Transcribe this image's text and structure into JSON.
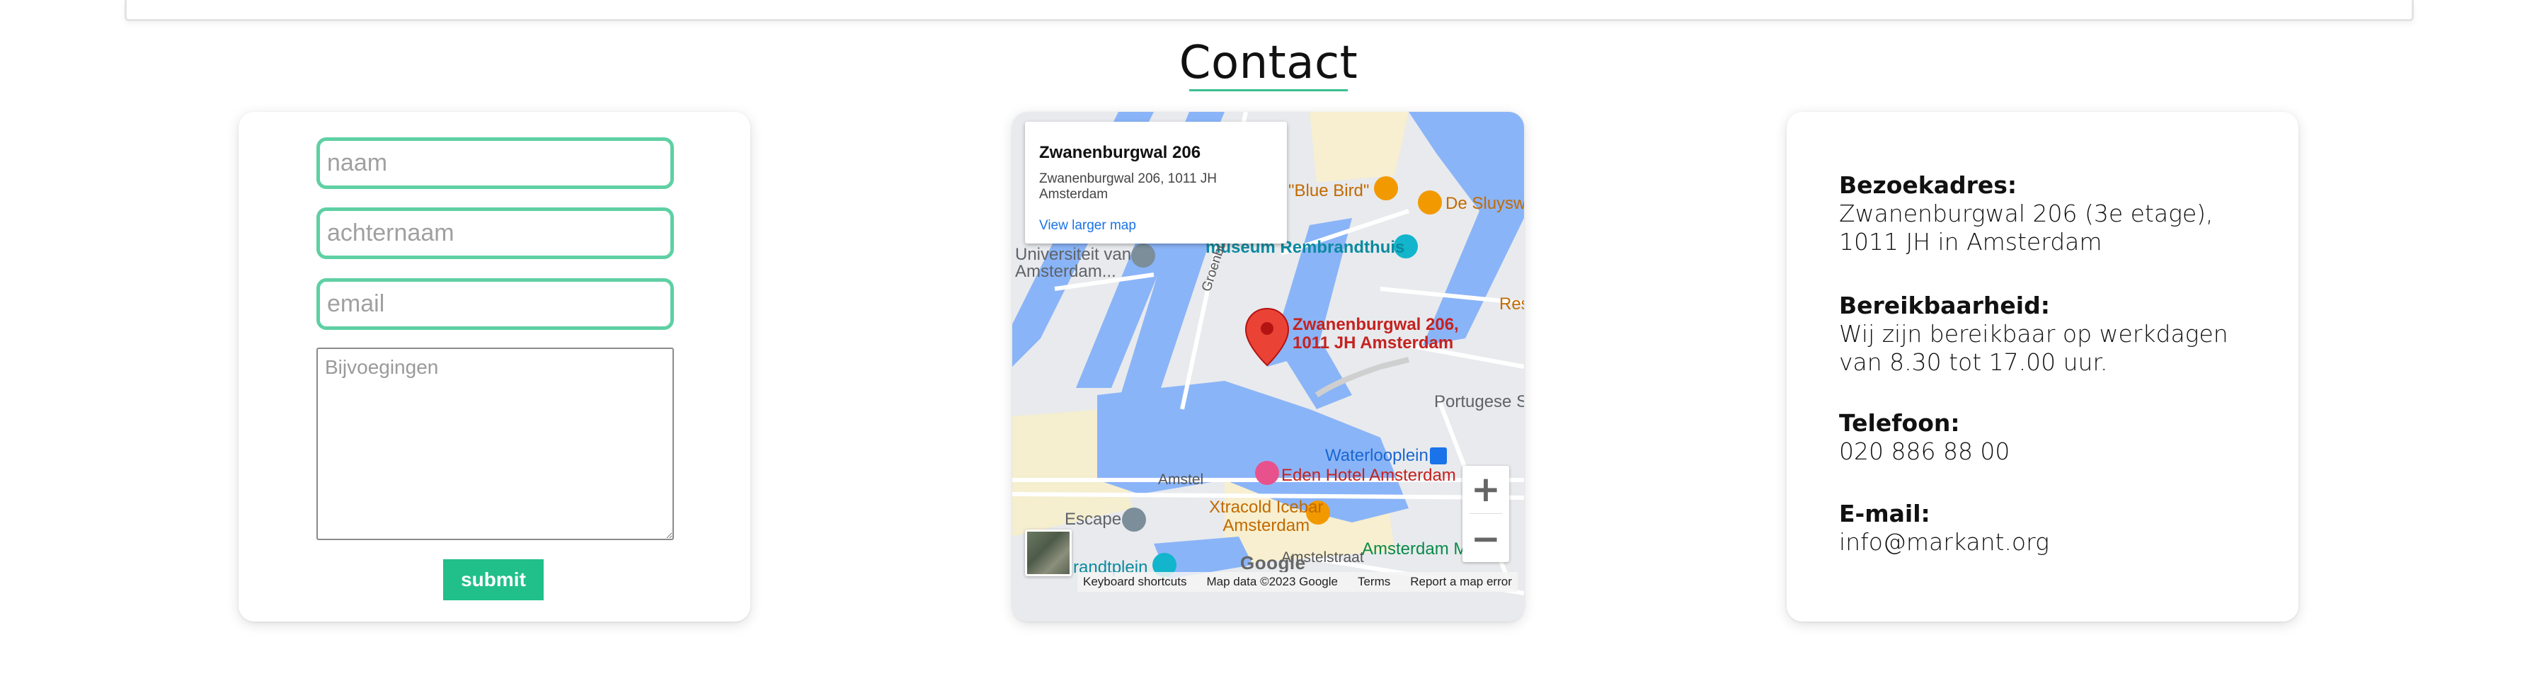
{
  "section": {
    "title": "Contact"
  },
  "form": {
    "fields": [
      {
        "placeholder": "naam"
      },
      {
        "placeholder": "achternaam"
      },
      {
        "placeholder": "email"
      }
    ],
    "attachments_placeholder": "Bijvoegingen",
    "submit_label": "submit"
  },
  "map": {
    "popup": {
      "title": "Zwanenburgwal 206",
      "address": "Zwanenburgwal 206, 1011 JH Amsterdam",
      "larger_map_link": "View larger map"
    },
    "marker_label_1": "Zwanenburgwal 206,",
    "marker_label_2": "1011 JH Amsterdam",
    "labels": {
      "blue_bird": "\"Blue Bird\"",
      "de_sluyswacht": "De Sluysw",
      "universiteit_1": "Universiteit van",
      "universiteit_2": "Amsterdam...",
      "museum": "museum Rembrandthuis",
      "groenburgwal": "Groenburgwal",
      "res": "Res",
      "portugese": "Portugese S",
      "waterlooplein": "Waterlooplein",
      "eden_hotel": "Eden Hotel Amsterdam",
      "amstel": "Amstel",
      "escape": "Escape",
      "xtracold_1": "Xtracold Icebar",
      "xtracold_2": "Amsterdam",
      "rembrandtplein": "randtplein",
      "amstelstraat": "Amstelstraat",
      "amsterdam_m": "Amsterdam M"
    },
    "zoom_in": "+",
    "zoom_out": "−",
    "google_logo": "Google",
    "attribution": {
      "shortcuts": "Keyboard shortcuts",
      "data": "Map data ©2023 Google",
      "terms": "Terms",
      "report": "Report a map error"
    },
    "colors": {
      "water": "#8ab4f8",
      "land": "#e8eaed",
      "park": "#f8f0d8",
      "marker": "#ea4335"
    }
  },
  "info": {
    "visit_label": "Bezoekadres:",
    "visit_text": "Zwanenburgwal 206 (3e etage), 1011 JH in Amsterdam",
    "reach_label": "Bereikbaarheid:",
    "reach_text": "Wij zijn bereikbaar op werkdagen van 8.30 tot 17.00 uur.",
    "phone_label": "Telefoon:",
    "phone_text": "020 886 88 00",
    "email_label": "E-mail:",
    "email_text": "info@markant.org"
  },
  "colors": {
    "accent": "#21bf8a",
    "field_border": "#5fd0a4"
  }
}
